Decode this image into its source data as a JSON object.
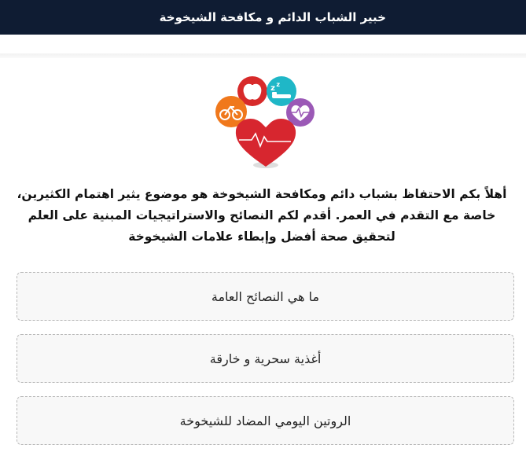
{
  "header": {
    "title": "خبير الشباب الدائم و مكافحة الشيخوخة"
  },
  "intro": {
    "text": "أهلاً بكم الاحتفاظ بشباب دائم ومكافحة الشيخوخة هو موضوع يثير اهتمام الكثيرين، خاصة مع التقدم في العمر. أقدم لكم النصائح والاستراتيجيات المبنية على العلم لتحقيق صحة أفضل وإبطاء علامات الشيخوخة"
  },
  "options": [
    {
      "label": "ما هي النصائح العامة"
    },
    {
      "label": "أغذية سحرية و خارقة"
    },
    {
      "label": "الروتين اليومي المضاد للشيخوخة"
    }
  ],
  "colors": {
    "header_bg": "#0f1c33",
    "heart": "#d7262f",
    "apple_circle": "#d72a2a",
    "sleep_circle": "#1fb7c7",
    "bike_circle": "#f0781c",
    "pulse_circle": "#9b59b6"
  },
  "icons": [
    "heart-icon",
    "apple-icon",
    "sleep-icon",
    "bicycle-icon",
    "heartbeat-icon"
  ]
}
